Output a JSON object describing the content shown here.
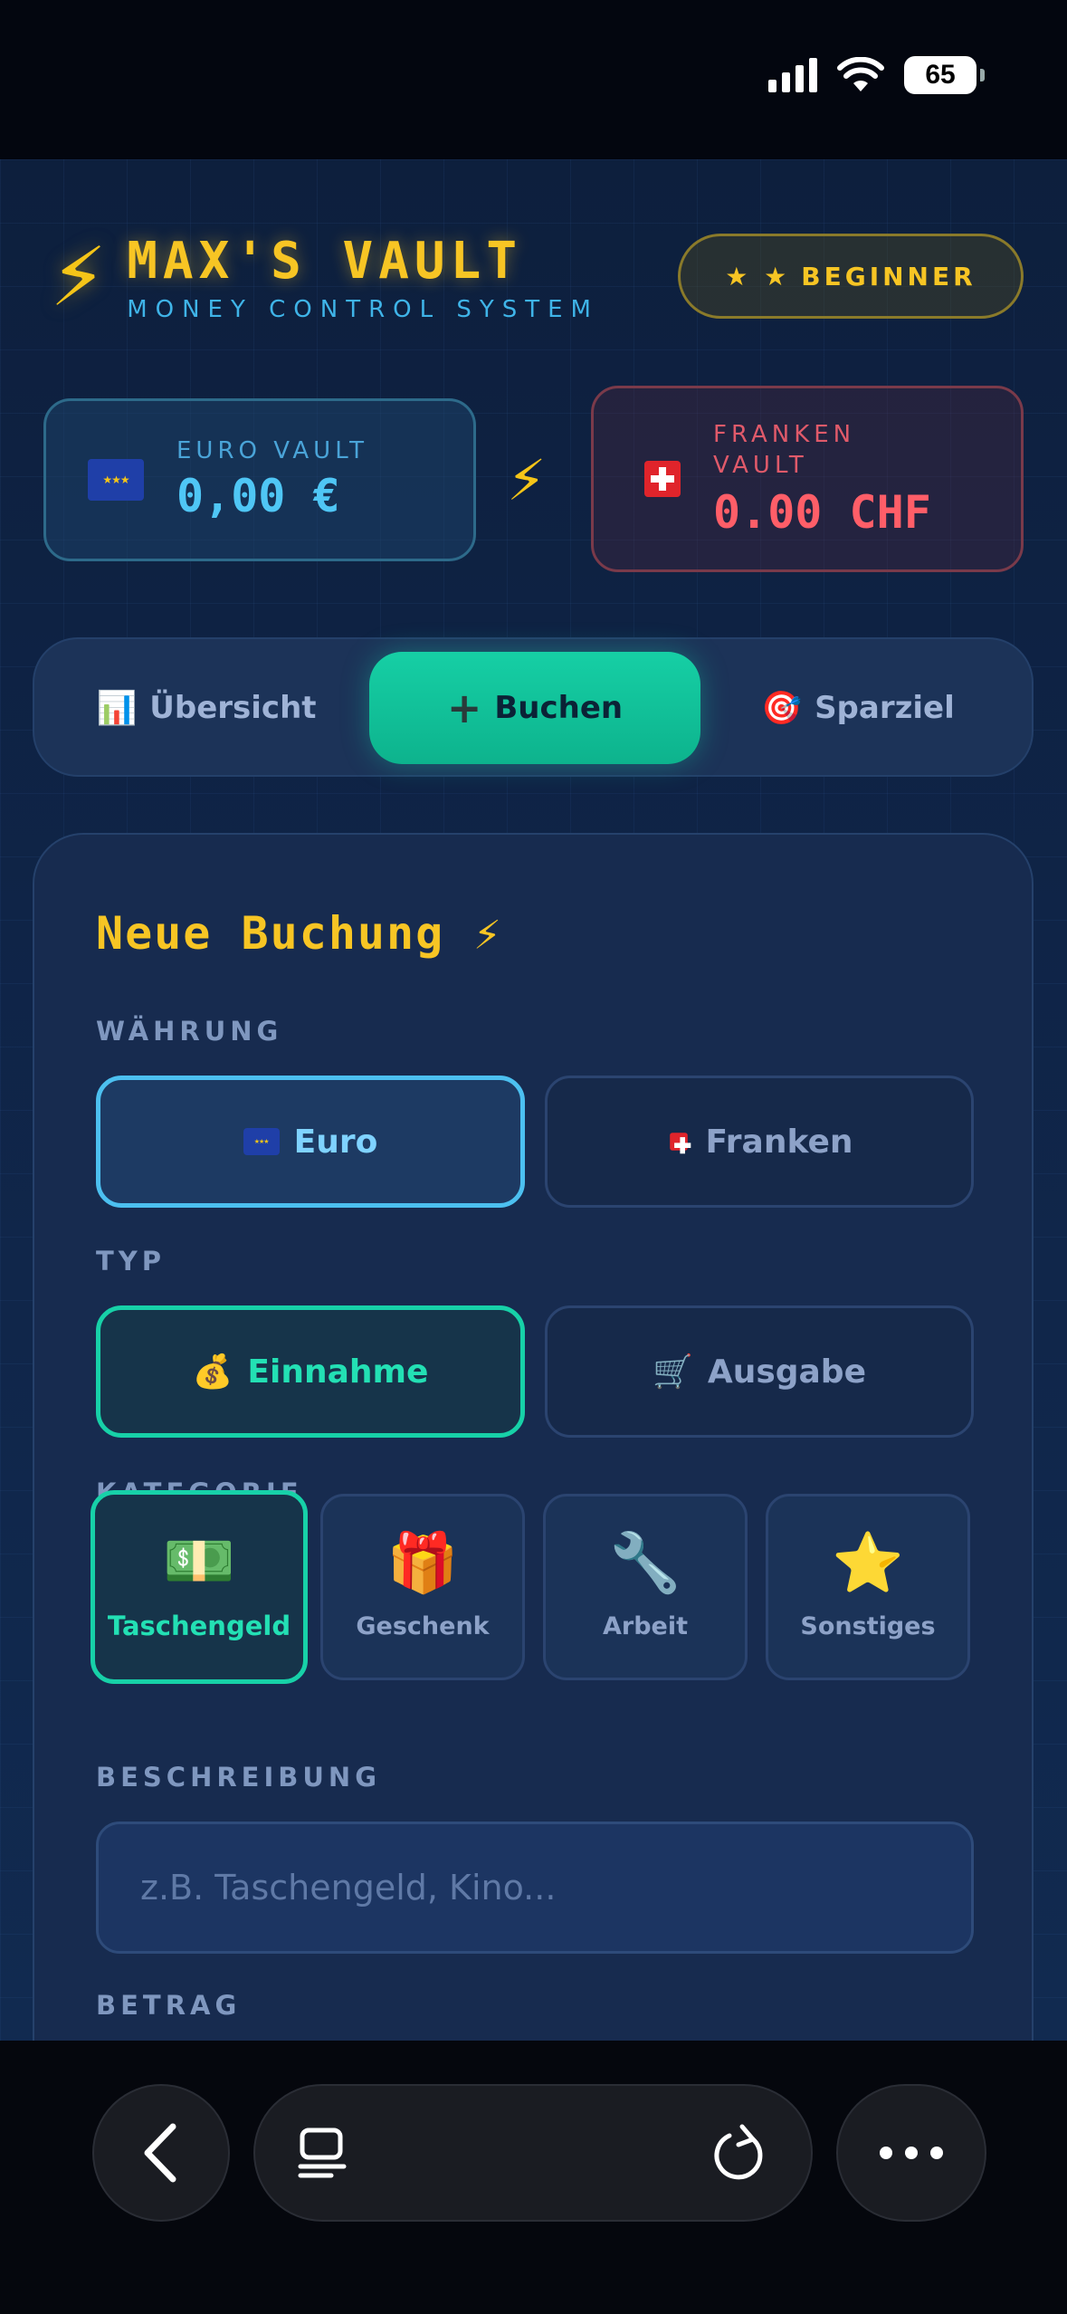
{
  "status_bar": {
    "battery": "65"
  },
  "header": {
    "title": "MAX'S VAULT",
    "subtitle": "MONEY CONTROL SYSTEM",
    "level_stars": "★ ★",
    "level_label": "BEGINNER"
  },
  "vaults": {
    "euro": {
      "label": "EURO VAULT",
      "amount": "0,00 €"
    },
    "chf": {
      "label": "FRANKEN VAULT",
      "amount": "0.00 CHF"
    }
  },
  "tabs": [
    {
      "icon": "📊",
      "label": "Übersicht",
      "active": false
    },
    {
      "icon": "+",
      "label": "Buchen",
      "active": true
    },
    {
      "icon": "🎯",
      "label": "Sparziel",
      "active": false
    }
  ],
  "form": {
    "title": "Neue Buchung ⚡",
    "currency_label": "WÄHRUNG",
    "currency_options": [
      "Euro",
      "Franken"
    ],
    "currency_selected": "Euro",
    "type_label": "TYP",
    "type_options": [
      {
        "icon": "💰",
        "label": "Einnahme"
      },
      {
        "icon": "🛒",
        "label": "Ausgabe"
      }
    ],
    "type_selected": "Einnahme",
    "category_label": "KATEGORIE",
    "categories": [
      {
        "icon": "💵",
        "label": "Taschengeld"
      },
      {
        "icon": "🎁",
        "label": "Geschenk"
      },
      {
        "icon": "🔧",
        "label": "Arbeit"
      },
      {
        "icon": "⭐",
        "label": "Sonstiges"
      }
    ],
    "category_selected": "Taschengeld",
    "description_label": "BESCHREIBUNG",
    "description_placeholder": "z.B. Taschengeld, Kino...",
    "amount_label": "BETRAG"
  },
  "colors": {
    "accent_green": "#17d1a8",
    "accent_gold": "#f7c524",
    "accent_blue": "#4cc0f0",
    "danger": "#ff5e68"
  }
}
